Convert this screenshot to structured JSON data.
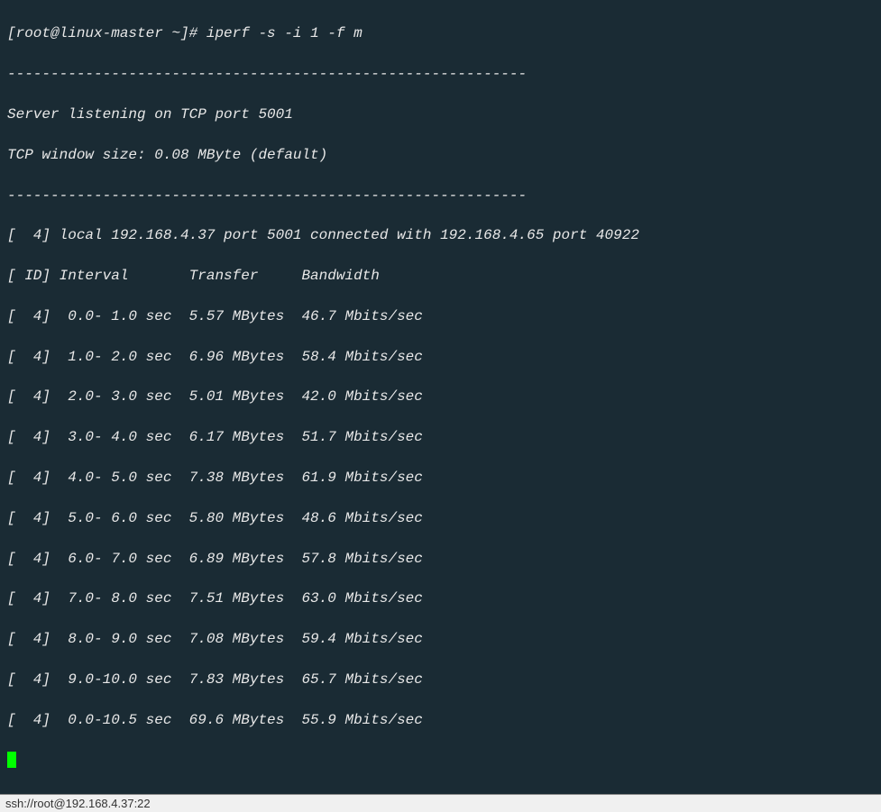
{
  "prompt": "[root@linux-master ~]# ",
  "command": "iperf -s -i 1 -f m",
  "separator": "------------------------------------------------------------",
  "server_listening": "Server listening on TCP port 5001",
  "window_size": "TCP window size: 0.08 MByte (default)",
  "connection": "[  4] local 192.168.4.37 port 5001 connected with 192.168.4.65 port 40922",
  "header": "[ ID] Interval       Transfer     Bandwidth",
  "rows": [
    "[  4]  0.0- 1.0 sec  5.57 MBytes  46.7 Mbits/sec",
    "[  4]  1.0- 2.0 sec  6.96 MBytes  58.4 Mbits/sec",
    "[  4]  2.0- 3.0 sec  5.01 MBytes  42.0 Mbits/sec",
    "[  4]  3.0- 4.0 sec  6.17 MBytes  51.7 Mbits/sec",
    "[  4]  4.0- 5.0 sec  7.38 MBytes  61.9 Mbits/sec",
    "[  4]  5.0- 6.0 sec  5.80 MBytes  48.6 Mbits/sec",
    "[  4]  6.0- 7.0 sec  6.89 MBytes  57.8 Mbits/sec",
    "[  4]  7.0- 8.0 sec  7.51 MBytes  63.0 Mbits/sec",
    "[  4]  8.0- 9.0 sec  7.08 MBytes  59.4 Mbits/sec",
    "[  4]  9.0-10.0 sec  7.83 MBytes  65.7 Mbits/sec",
    "[  4]  0.0-10.5 sec  69.6 MBytes  55.9 Mbits/sec"
  ],
  "statusbar": "ssh://root@192.168.4.37:22",
  "chart_data": {
    "type": "table",
    "title": "iperf bandwidth report (server mode, TCP port 5001)",
    "columns": [
      "ID",
      "Interval (sec)",
      "Transfer (MBytes)",
      "Bandwidth (Mbits/sec)"
    ],
    "rows": [
      [
        4,
        "0.0-1.0",
        5.57,
        46.7
      ],
      [
        4,
        "1.0-2.0",
        6.96,
        58.4
      ],
      [
        4,
        "2.0-3.0",
        5.01,
        42.0
      ],
      [
        4,
        "3.0-4.0",
        6.17,
        51.7
      ],
      [
        4,
        "4.0-5.0",
        7.38,
        61.9
      ],
      [
        4,
        "5.0-6.0",
        5.8,
        48.6
      ],
      [
        4,
        "6.0-7.0",
        6.89,
        57.8
      ],
      [
        4,
        "7.0-8.0",
        7.51,
        63.0
      ],
      [
        4,
        "8.0-9.0",
        7.08,
        59.4
      ],
      [
        4,
        "9.0-10.0",
        7.83,
        65.7
      ],
      [
        4,
        "0.0-10.5",
        69.6,
        55.9
      ]
    ]
  }
}
